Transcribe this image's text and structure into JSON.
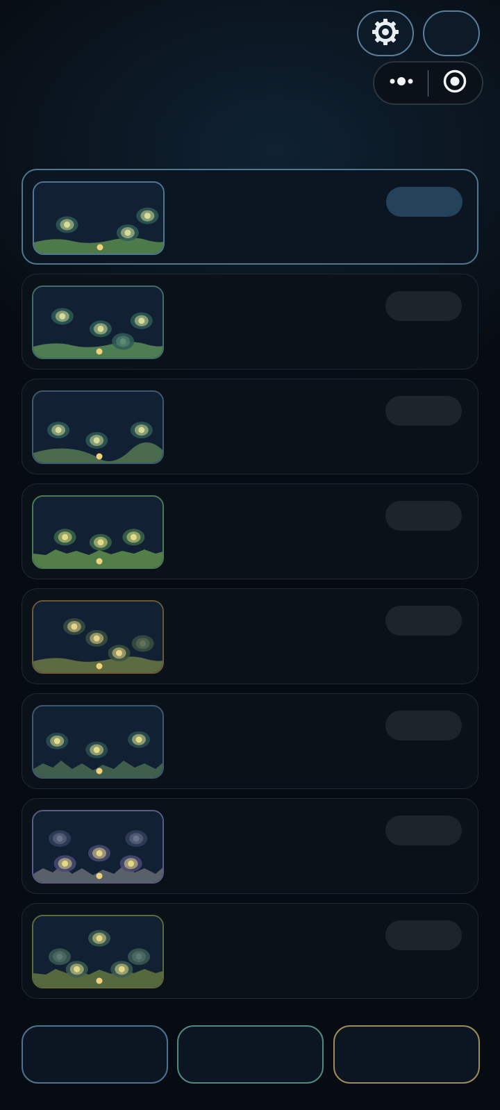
{
  "header": {
    "settings_icon": "gear-icon",
    "secondary_button": "blank-round-button",
    "capsule": {
      "more_icon": "more-dots-icon",
      "close_icon": "target-circle-icon"
    }
  },
  "levels": [
    {
      "border": "#4e7890",
      "active": true,
      "ground": "#4e7a4a",
      "shape": "wave",
      "orbs": [
        [
          0.25,
          0.57,
          "#d7dc98",
          "#2e5a56"
        ],
        [
          0.86,
          0.45,
          "#d7dc98",
          "#2e5a56"
        ],
        [
          0.71,
          0.68,
          "#d7dc98",
          "#2e5a56"
        ]
      ]
    },
    {
      "border": "#3f6e6a",
      "active": false,
      "ground": "#4f7d52",
      "shape": "wave",
      "orbs": [
        [
          0.22,
          0.4,
          "#d7dc98",
          "#2e5a56"
        ],
        [
          0.51,
          0.57,
          "#d7dc98",
          "#2e5a56"
        ],
        [
          0.82,
          0.46,
          "#d7dc98",
          "#2e5a56"
        ],
        [
          0.68,
          0.74,
          "#5c8c74",
          "#2e5a56"
        ]
      ]
    },
    {
      "border": "#3d5a72",
      "active": false,
      "ground": "#496a4c",
      "shape": "valley",
      "orbs": [
        [
          0.19,
          0.52,
          "#d7dc98",
          "#2e5a56"
        ],
        [
          0.48,
          0.66,
          "#d7dc98",
          "#2e5a56"
        ],
        [
          0.82,
          0.52,
          "#d7dc98",
          "#2e5a56"
        ]
      ]
    },
    {
      "border": "#4c7a54",
      "active": false,
      "ground": "#537e48",
      "shape": "zigzag",
      "orbs": [
        [
          0.24,
          0.55,
          "#e3dc88",
          "#3a6648"
        ],
        [
          0.51,
          0.62,
          "#e3dc88",
          "#3a6648"
        ],
        [
          0.76,
          0.55,
          "#e3dc88",
          "#3a6648"
        ]
      ]
    },
    {
      "border": "#6a5a3c",
      "active": false,
      "ground": "#5c6b42",
      "shape": "wave",
      "orbs": [
        [
          0.31,
          0.34,
          "#e8d58a",
          "#3a4f42"
        ],
        [
          0.48,
          0.5,
          "#e8d58a",
          "#3a4f42"
        ],
        [
          0.65,
          0.7,
          "#e8d58a",
          "#3a4f42"
        ],
        [
          0.83,
          0.57,
          "#62735a",
          "#3a4f42"
        ]
      ]
    },
    {
      "border": "#3d5a72",
      "active": false,
      "ground": "#3f5e4c",
      "shape": "jagged",
      "orbs": [
        [
          0.18,
          0.47,
          "#e3dc88",
          "#2c5052"
        ],
        [
          0.48,
          0.59,
          "#e3dc88",
          "#2c5052"
        ],
        [
          0.8,
          0.45,
          "#e3dc88",
          "#2c5052"
        ]
      ]
    },
    {
      "border": "#5e5a86",
      "active": false,
      "ground": "#58616a",
      "shape": "jagged",
      "orbs": [
        [
          0.2,
          0.37,
          "#6c7388",
          "#34405a"
        ],
        [
          0.78,
          0.37,
          "#6c7388",
          "#34405a"
        ],
        [
          0.5,
          0.57,
          "#e3d888",
          "#4a4a72"
        ],
        [
          0.24,
          0.71,
          "#e3d888",
          "#4a4a72"
        ],
        [
          0.74,
          0.71,
          "#e3d888",
          "#4a4a72"
        ]
      ]
    },
    {
      "border": "#5d6a3c",
      "active": false,
      "ground": "#56693e",
      "shape": "zigzag",
      "orbs": [
        [
          0.5,
          0.3,
          "#e3d888",
          "#3a5a52"
        ],
        [
          0.2,
          0.55,
          "#5d7870",
          "#3a5a52"
        ],
        [
          0.8,
          0.55,
          "#5d7870",
          "#3a5a52"
        ],
        [
          0.33,
          0.72,
          "#e3d888",
          "#3a5a52"
        ],
        [
          0.67,
          0.72,
          "#e3d888",
          "#3a5a52"
        ]
      ]
    }
  ],
  "bottom_buttons": [
    {
      "border": "#4b7394"
    },
    {
      "border": "#4e8a80"
    },
    {
      "border": "#a08c58"
    }
  ]
}
